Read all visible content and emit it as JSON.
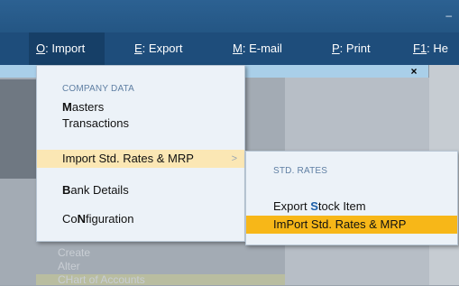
{
  "menubar": {
    "items": [
      {
        "key": "O",
        "rest": ": Import"
      },
      {
        "key": "E",
        "rest": ": Export"
      },
      {
        "key": "M",
        "rest": ": E-mail"
      },
      {
        "key": "P",
        "rest": ": Print"
      },
      {
        "key": "F1",
        "rest": ": He"
      }
    ]
  },
  "titlebar": {
    "minimize": "–"
  },
  "close_glyph": "×",
  "import_menu": {
    "section": "COMPANY DATA",
    "items": [
      {
        "hot": "M",
        "rest": "asters"
      },
      {
        "label": "Transactions"
      },
      {
        "label": "Import Std. Rates & MRP"
      },
      {
        "hot": "B",
        "rest": "ank Details"
      },
      {
        "pre": "Co",
        "hot": "N",
        "rest": "figuration"
      }
    ],
    "submenu_arrow": ">"
  },
  "submenu": {
    "section": "STD. RATES",
    "items": [
      {
        "pre": "Export ",
        "hot": "S",
        "rest": "tock Item"
      },
      {
        "label": "ImPort Std. Rates & MRP"
      }
    ]
  },
  "background": {
    "ghost_items": [
      "Create",
      "Alter",
      "CHart of Accounts"
    ]
  }
}
